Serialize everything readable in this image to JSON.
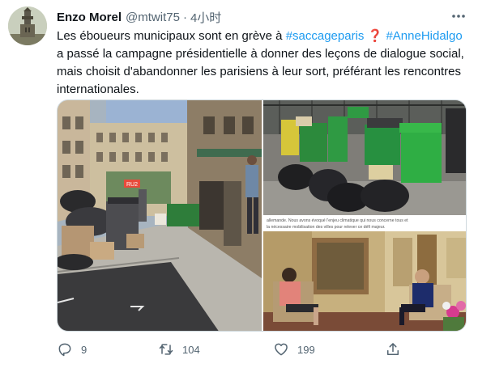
{
  "tweet": {
    "author_name": "Enzo Morel",
    "handle": "@mtwit75",
    "separator": "·",
    "time": "4小时",
    "text_before": "Les éboueurs municipaux sont en grève à ",
    "hashtag_1": "#saccageparis",
    "mark": "❓",
    "hashtag_2": "#AnneHidalgo",
    "text_after": "a passé la campagne présidentielle à donner des leçons de dialogue social, mais choisit d'abandonner les parisiens à leur sort, préférant les rencontres internationales."
  },
  "media": {
    "photo_1": {
      "sign_text": "RU2"
    },
    "photo_3": {
      "caption_line_1": "allemande. Nous avons évoqué l'enjeu climatique qui nous concerne tous et",
      "caption_line_2": "la nécessaire mobilisation des villes pour relever ce défi majeur."
    }
  },
  "actions": {
    "reply": {
      "icon": "reply-icon",
      "count": "9"
    },
    "retweet": {
      "icon": "retweet-icon",
      "count": "104"
    },
    "like": {
      "icon": "heart-icon",
      "count": "199"
    },
    "share": {
      "icon": "share-icon"
    }
  },
  "colors": {
    "accent": "#1d9bf0",
    "text": "#0f1419",
    "secondary": "#536471",
    "question_mark": "#d8222b"
  }
}
